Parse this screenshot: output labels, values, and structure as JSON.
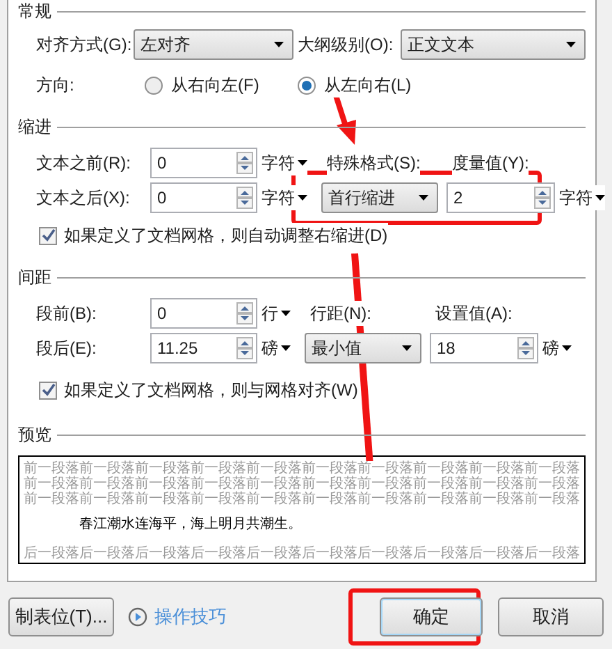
{
  "general": {
    "title": "常规",
    "alignment": {
      "label": "对齐方式(G):",
      "value": "左对齐"
    },
    "outline_level": {
      "label": "大纲级别(O):",
      "value": "正文文本"
    },
    "direction": {
      "label": "方向:",
      "options": [
        {
          "label": "从右向左(F)",
          "selected": false
        },
        {
          "label": "从左向右(L)",
          "selected": true
        }
      ]
    }
  },
  "indent": {
    "title": "缩进",
    "before": {
      "label": "文本之前(R):",
      "value": "0",
      "unit": "字符"
    },
    "after": {
      "label": "文本之后(X):",
      "value": "0",
      "unit": "字符"
    },
    "special": {
      "label": "特殊格式(S):",
      "value": "首行缩进"
    },
    "amount": {
      "label": "度量值(Y):",
      "value": "2",
      "unit": "字符"
    },
    "auto_adjust": {
      "label": "如果定义了文档网格，则自动调整右缩进(D)",
      "checked": true
    }
  },
  "spacing": {
    "title": "间距",
    "before": {
      "label": "段前(B):",
      "value": "0",
      "unit": "行"
    },
    "after": {
      "label": "段后(E):",
      "value": "11.25",
      "unit": "磅"
    },
    "line_spacing": {
      "label": "行距(N):",
      "value": "最小值"
    },
    "set_value": {
      "label": "设置值(A):",
      "value": "18",
      "unit": "磅"
    },
    "snap_to_grid": {
      "label": "如果定义了文档网格，则与网格对齐(W)",
      "checked": true
    }
  },
  "preview": {
    "title": "预览",
    "previous_lines": [
      "前一段落前一段落前一段落前一段落前一段落前一段落前一段落前一段落前一段落前一段落",
      "前一段落前一段落前一段落前一段落前一段落前一段落前一段落前一段落前一段落前一段落",
      "前一段落前一段落前一段落前一段落前一段落前一段落前一段落前一段落前一段落前一段落"
    ],
    "sample": "春江潮水连海平，海上明月共潮生。",
    "next_lines": [
      "后一段落后一段落后一段落后一段落后一段落后一段落后一段落后一段落后一段落后一段落"
    ]
  },
  "footer": {
    "tabs_button": "制表位(T)...",
    "tips_link": "操作技巧",
    "ok": "确定",
    "cancel": "取消"
  }
}
